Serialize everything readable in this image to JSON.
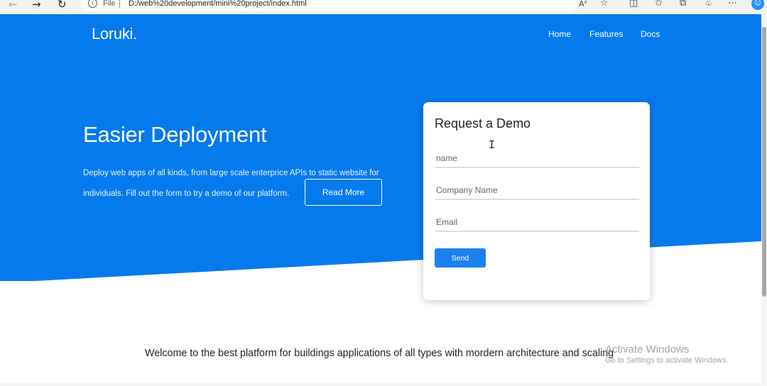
{
  "browser": {
    "file_label": "File",
    "url": "D:/web%20development/mini%20project/index.html",
    "icons": {
      "back": "arrow-left-icon",
      "forward": "arrow-right-icon",
      "reload": "reload-icon",
      "info": "info-icon",
      "read_aloud": "read-aloud-icon",
      "favorite": "star-icon",
      "split": "split-screen-icon",
      "favorites": "favorites-icon",
      "collections": "collections-icon",
      "extensions": "extensions-icon",
      "more": "more-icon",
      "profile": "profile-icon"
    }
  },
  "site": {
    "logo": "Loruki.",
    "nav": [
      "Home",
      "Features",
      "Docs"
    ],
    "hero": {
      "title": "Easier Deployment",
      "text": "Deploy web apps of all kinds, from large scale enterprice APIs to static website for individuals. Fill out the form to try a demo of our platform.",
      "read_more": "Read More"
    },
    "form": {
      "title": "Request a Demo",
      "name_placeholder": "name",
      "company_placeholder": "Company Name",
      "email_placeholder": "Email",
      "send": "Send"
    },
    "welcome": "Welcome to the best platform for buildings applications of all types with mordern architecture and scaling"
  },
  "watermark": {
    "line1": "Activate Windows",
    "line2": "Go to Settings to activate Windows."
  },
  "colors": {
    "primary": "#047aed",
    "button": "#1a82f0",
    "background": "#ffffff"
  }
}
